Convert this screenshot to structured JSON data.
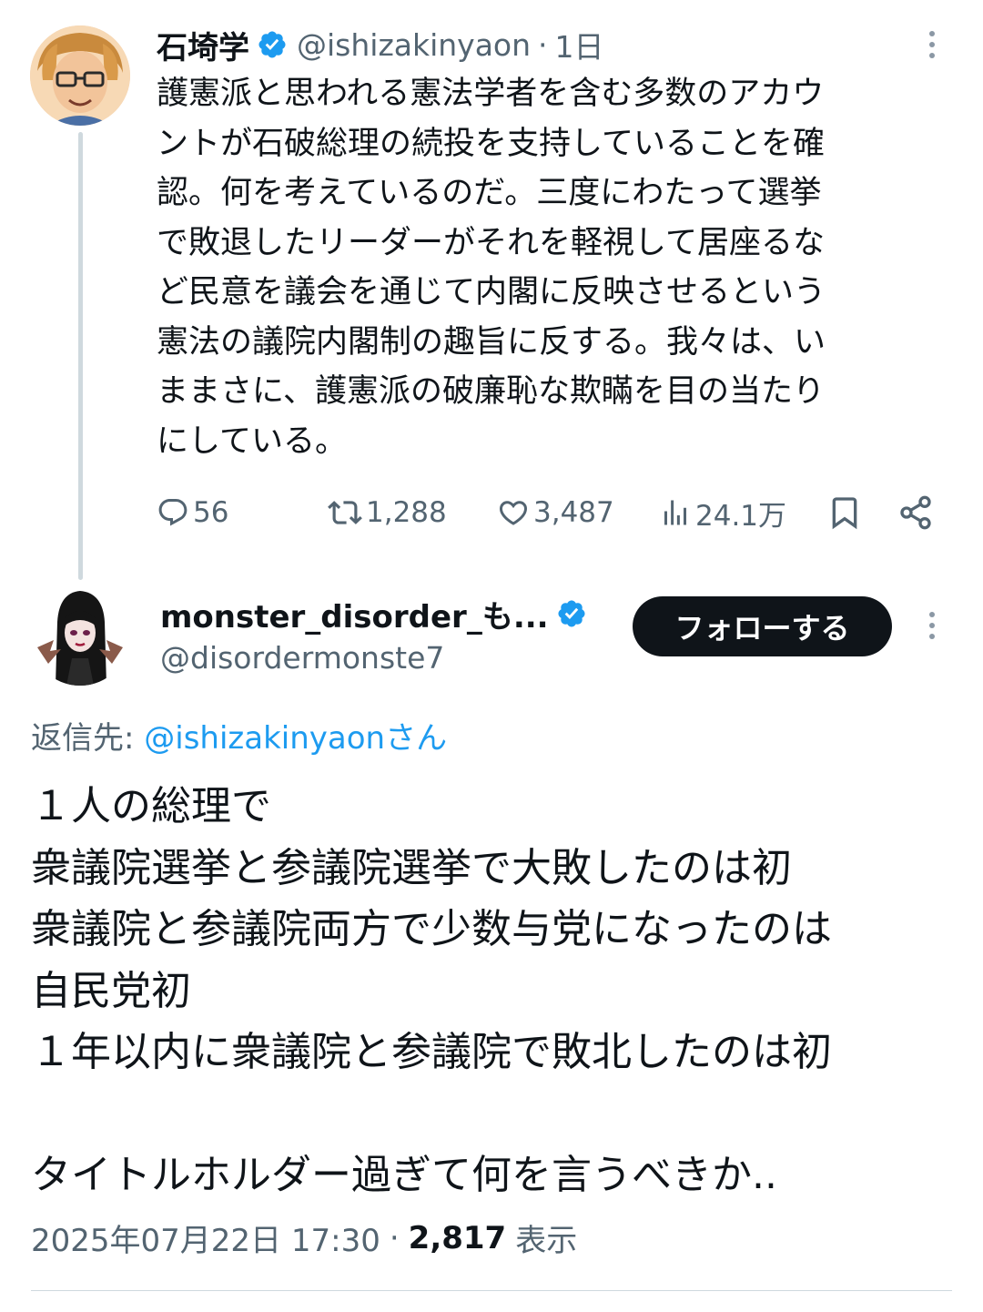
{
  "tweet1": {
    "author_name": "石埼学",
    "author_handle": "@ishizakinyaon",
    "separator": "·",
    "time": "1日",
    "text": "護憲派と思われる憲法学者を含む多数のアカウントが石破総理の続投を支持していることを確認。何を考えているのだ。三度にわたって選挙で敗退したリーダーがそれを軽視して居座るなど民意を議会を通じて内閣に反映させるという憲法の議院内閣制の趣旨に反する。我々は、いままさに、護憲派の破廉恥な欺瞞を目の当たりにしている。",
    "lines": [
      "護憲派と思われる憲法学者を含む多数のアカウ",
      "ントが石破総理の続投を支持していることを確",
      "認。何を考えているのだ。三度にわたって選挙",
      "で敗退したリーダーがそれを軽視して居座るな",
      "ど民意を議会を通じて内閣に反映させるという",
      "憲法の議院内閣制の趣旨に反する。我々は、い",
      "ままさに、護憲派の破廉恥な欺瞞を目の当たり",
      "にしている。"
    ],
    "replies": "56",
    "retweets": "1,288",
    "likes": "3,487",
    "views": "24.1万",
    "icons": [
      "reply-icon",
      "retweet-icon",
      "like-icon",
      "views-icon",
      "bookmark-icon",
      "share-icon",
      "more-icon",
      "verified-icon"
    ]
  },
  "tweet2": {
    "author_name": "monster_disorder_も...",
    "author_handle": "@disordermonste7",
    "follow_label": "フォローする",
    "reply_prefix": "返信先: ",
    "reply_mention": "@ishizakinyaon",
    "reply_suffix": "さん",
    "lines": [
      "１人の総理で",
      "衆議院選挙と参議院選挙で大敗したのは初",
      "衆議院と参議院両方で少数与党になったのは",
      "自民党初",
      "１年以内に衆議院と参議院で敗北したのは初",
      "",
      "タイトルホルダー過ぎて何を言うべきか.."
    ],
    "timestamp": "2025年07月22日 17:30",
    "separator": "·",
    "views_count": "2,817",
    "views_label": "表示"
  },
  "colors": {
    "text": "#0f1419",
    "secondary": "#536471",
    "link": "#1d9bf0",
    "verified": "#1d9bf0",
    "button_bg": "#0f1419",
    "line": "#cfd9de"
  }
}
